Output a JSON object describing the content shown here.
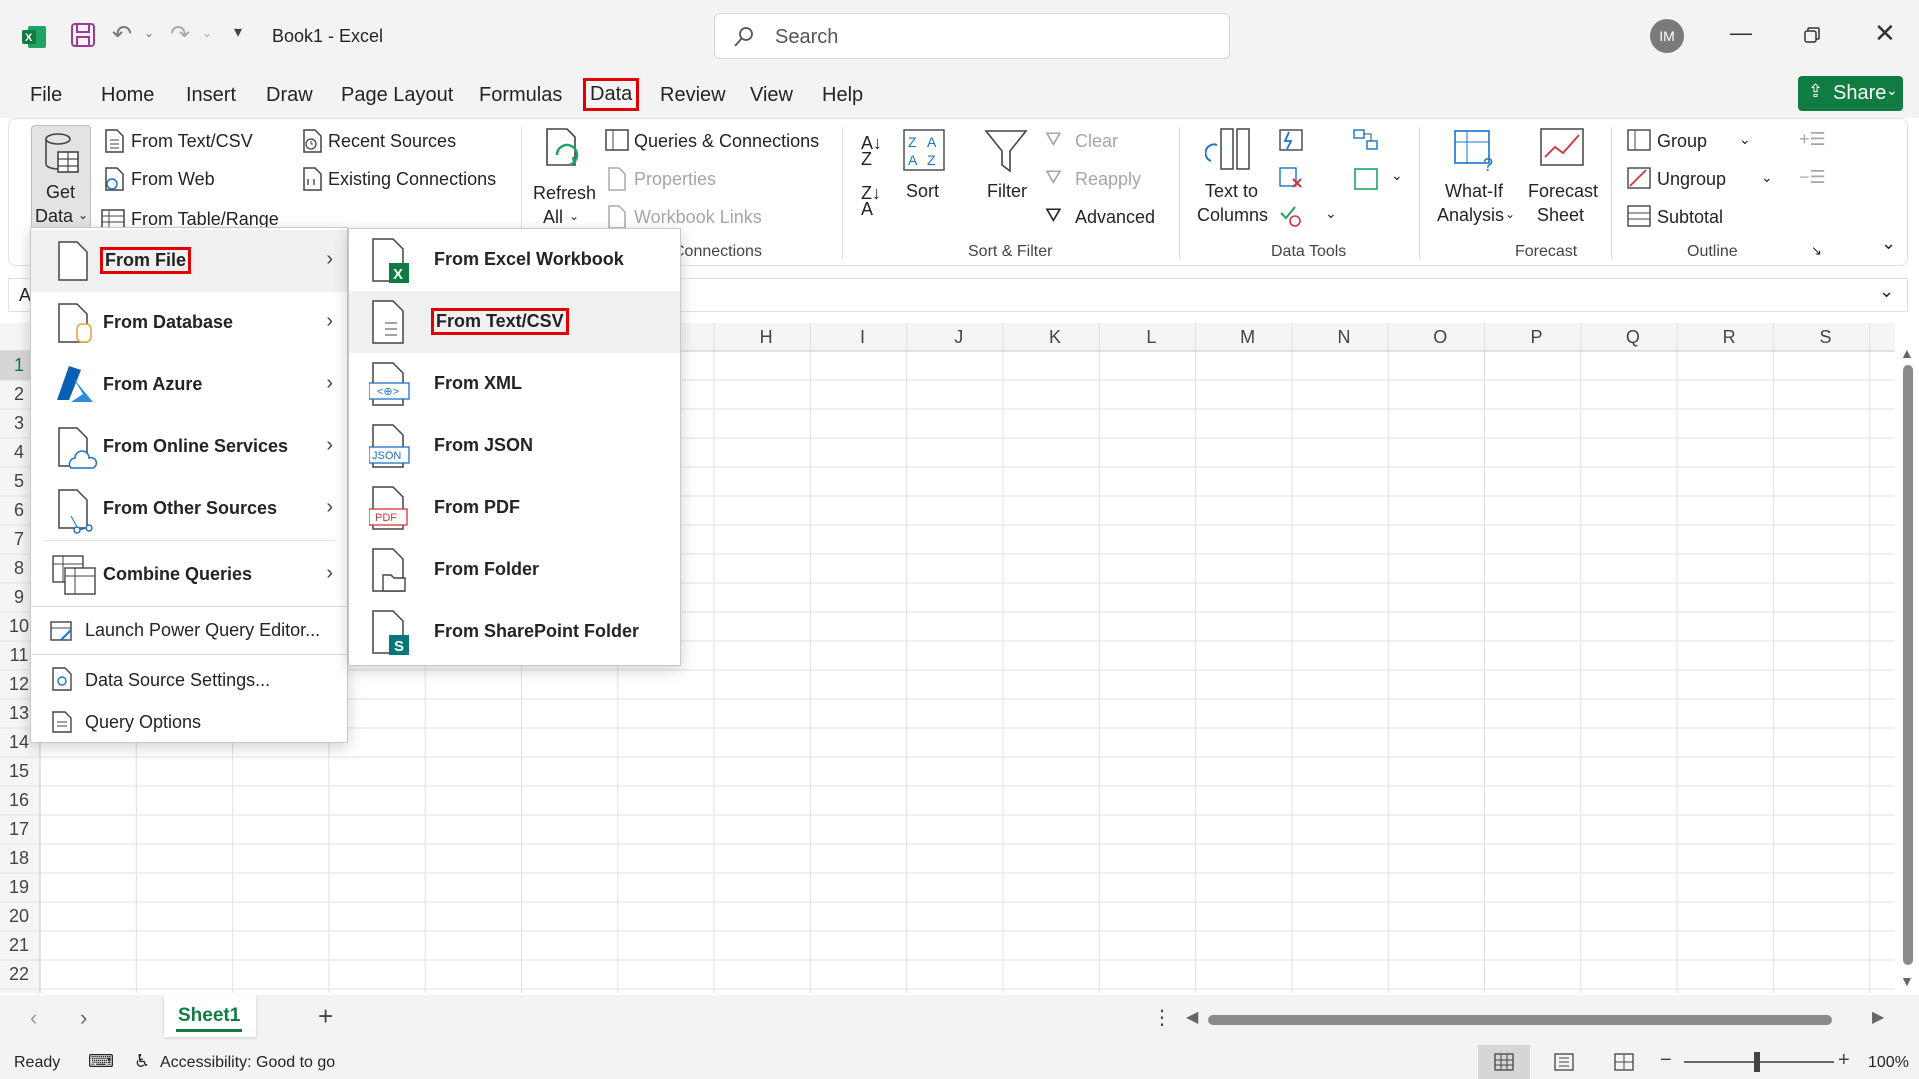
{
  "titlebar": {
    "doc_title": "Book1  -  Excel",
    "search_placeholder": "Search",
    "avatar_initials": "IM"
  },
  "tabs": [
    "File",
    "Home",
    "Insert",
    "Draw",
    "Page Layout",
    "Formulas",
    "Data",
    "Review",
    "View",
    "Help"
  ],
  "share_label": "Share",
  "ribbon": {
    "get_data": [
      "Get",
      "Data"
    ],
    "from_text_csv": "From Text/CSV",
    "from_web": "From Web",
    "from_table_range": "From Table/Range",
    "recent_sources": "Recent Sources",
    "existing_connections": "Existing Connections",
    "refresh_all": [
      "Refresh",
      "All"
    ],
    "queries_connections": "Queries & Connections",
    "properties": "Properties",
    "workbook_links": "Workbook Links",
    "connections_group": "Connections",
    "sort": "Sort",
    "filter": "Filter",
    "clear": "Clear",
    "reapply": "Reapply",
    "advanced": "Advanced",
    "sort_filter_group": "Sort & Filter",
    "text_to_columns": [
      "Text to",
      "Columns"
    ],
    "data_tools_group": "Data Tools",
    "what_if": [
      "What-If",
      "Analysis"
    ],
    "forecast_sheet": [
      "Forecast",
      "Sheet"
    ],
    "forecast_group": "Forecast",
    "group": "Group",
    "ungroup": "Ungroup",
    "subtotal": "Subtotal",
    "outline_group": "Outline"
  },
  "namebox_partial": "A",
  "columns": [
    "H",
    "I",
    "J",
    "K",
    "L",
    "M",
    "N",
    "O",
    "P",
    "Q",
    "R",
    "S"
  ],
  "rows": [
    "1",
    "2",
    "3",
    "4",
    "5",
    "6",
    "7",
    "8",
    "9",
    "10",
    "11",
    "12",
    "13",
    "14",
    "15",
    "16",
    "17",
    "18",
    "19",
    "20",
    "21",
    "22"
  ],
  "get_data_menu": {
    "items": [
      {
        "label": "From File",
        "submenu": true
      },
      {
        "label": "From Database",
        "submenu": true
      },
      {
        "label": "From Azure",
        "submenu": true
      },
      {
        "label": "From Online Services",
        "submenu": true
      },
      {
        "label": "From Other Sources",
        "submenu": true
      },
      {
        "label": "Combine Queries",
        "submenu": true
      }
    ],
    "launch_pq": "Launch Power Query Editor...",
    "data_source_settings": "Data Source Settings...",
    "query_options": "Query Options"
  },
  "from_file_menu": {
    "items": [
      "From Excel Workbook",
      "From Text/CSV",
      "From XML",
      "From JSON",
      "From PDF",
      "From Folder",
      "From SharePoint Folder"
    ]
  },
  "sheet_tab": "Sheet1",
  "status": {
    "ready": "Ready",
    "accessibility": "Accessibility: Good to go",
    "zoom": "100%"
  },
  "colors": {
    "highlight": "#e00000",
    "excel_green": "#107c41"
  }
}
